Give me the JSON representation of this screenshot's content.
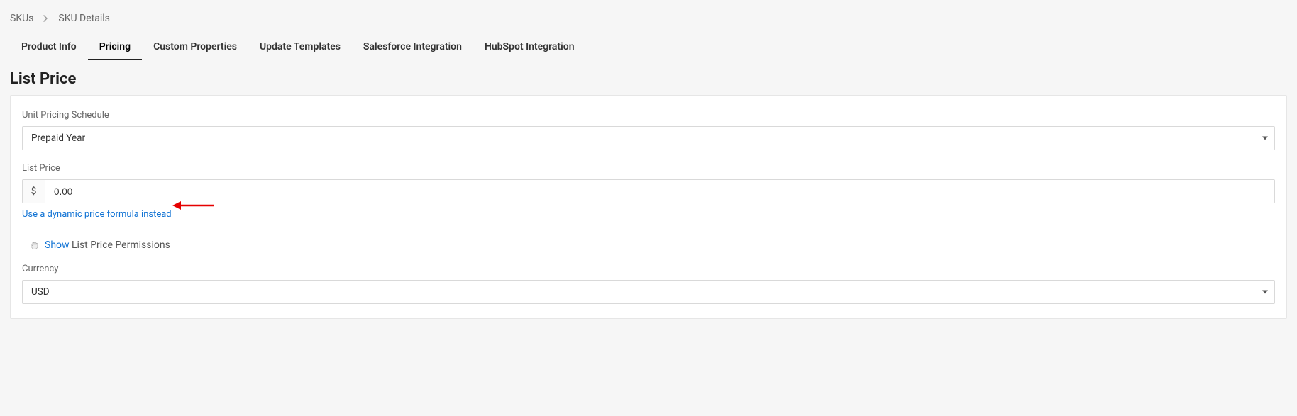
{
  "breadcrumb": {
    "parent": "SKUs",
    "current": "SKU Details"
  },
  "tabs": [
    {
      "label": "Product Info",
      "active": false
    },
    {
      "label": "Pricing",
      "active": true
    },
    {
      "label": "Custom Properties",
      "active": false
    },
    {
      "label": "Update Templates",
      "active": false
    },
    {
      "label": "Salesforce Integration",
      "active": false
    },
    {
      "label": "HubSpot Integration",
      "active": false
    }
  ],
  "section_title": "List Price",
  "fields": {
    "unit_pricing_schedule": {
      "label": "Unit Pricing Schedule",
      "value": "Prepaid Year"
    },
    "list_price": {
      "label": "List Price",
      "currency_symbol": "$",
      "value": "0.00",
      "dynamic_link": "Use a dynamic price formula instead"
    },
    "permissions": {
      "show_text": "Show",
      "rest_text": " List Price Permissions"
    },
    "currency": {
      "label": "Currency",
      "value": "USD"
    }
  }
}
